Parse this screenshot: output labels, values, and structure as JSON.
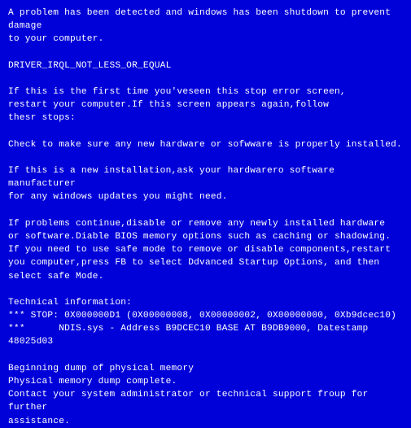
{
  "bsod": {
    "intro_line1": "A problem has been detected and windows has been shutdown to prevent damage",
    "intro_line2": "to your computer.",
    "error_code": "DRIVER_IRQL_NOT_LESS_OR_EQUAL",
    "first_time_l1": "If this is the first time you'veseen this stop error screen,",
    "first_time_l2": "restart your computer.If this screen appears again,follow",
    "first_time_l3": "thesr stops:",
    "check_hw": "Check to make sure any new hardware or sofwware is properly installed.",
    "new_install_l1": "If this is a new installation,ask your hardwarero software manufacturer",
    "new_install_l2": "for any windows updates you might need.",
    "problems_l1": "If problems continue,disable or remove any newly installed hardware",
    "problems_l2": "or software.Diable BIOS memory options such as caching or shadowing.",
    "problems_l3": "If you need to use safe mode to remove or disable components,restart",
    "problems_l4": "you computer,press FB to select Ddvanced Startup Options, and then",
    "problems_l5": "select safe Mode.",
    "tech_header": "Technical information:",
    "stop_line": "*** STOP: 0X000000D1 (0X00000008, 0X00000002, 0X00000000, 0Xb9dcec10)",
    "driver_line": "***      NDIS.sys - Address B9DCEC10 BASE AT B9DB9000, Datestamp 48025d03",
    "dump_l1": "Beginning dump of physical memory",
    "dump_l2": "Physical memory dump complete.",
    "dump_l3": "Contact your system administrator or technical support froup for further",
    "dump_l4": "assistance."
  }
}
